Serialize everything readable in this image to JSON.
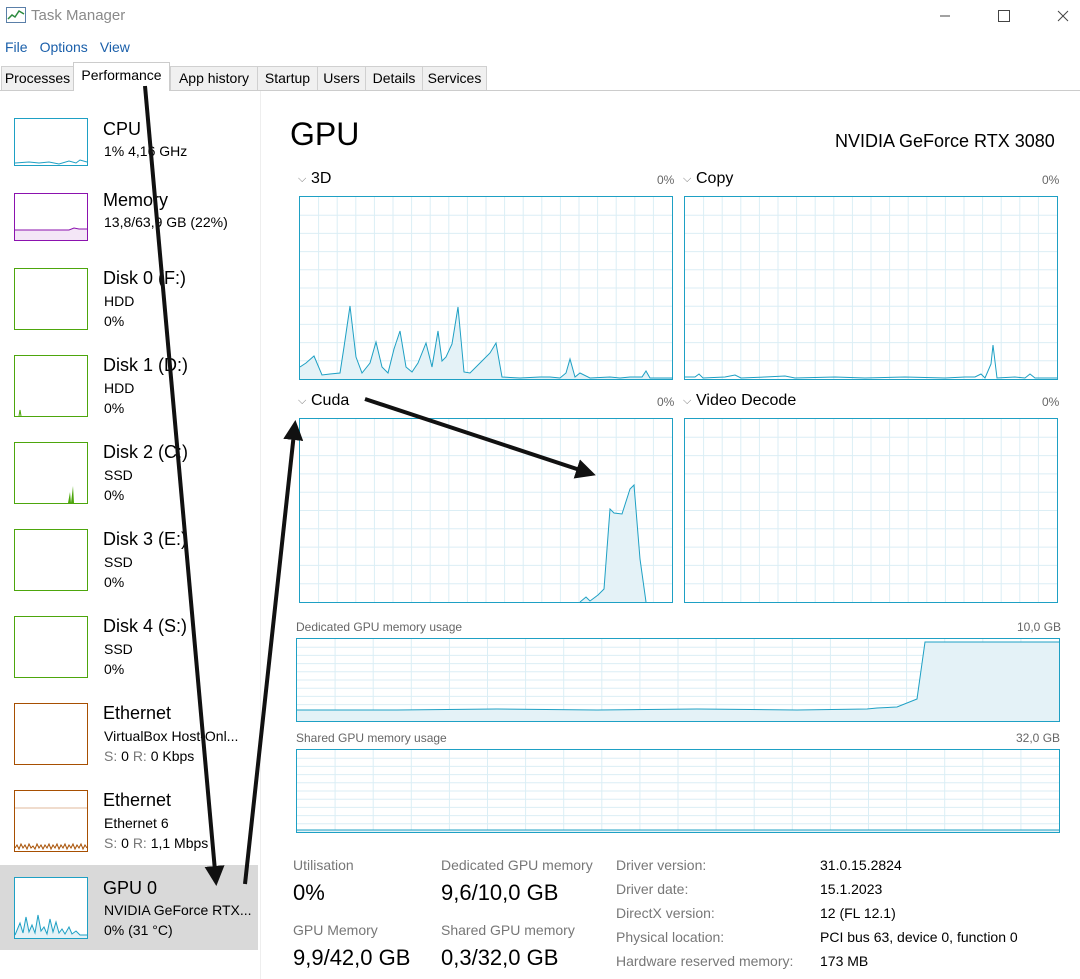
{
  "window": {
    "title": "Task Manager"
  },
  "menu": [
    "File",
    "Options",
    "View"
  ],
  "tabs": [
    "Processes",
    "Performance",
    "App history",
    "Startup",
    "Users",
    "Details",
    "Services"
  ],
  "sidebar": [
    {
      "name": "CPU",
      "line1": "1%  4,16 GHz",
      "line2": ""
    },
    {
      "name": "Memory",
      "line1": "13,8/63,9 GB (22%)",
      "line2": ""
    },
    {
      "name": "Disk 0 (F:)",
      "line1": "HDD",
      "line2": "0%"
    },
    {
      "name": "Disk 1 (D:)",
      "line1": "HDD",
      "line2": "0%"
    },
    {
      "name": "Disk 2 (C:)",
      "line1": "SSD",
      "line2": "0%"
    },
    {
      "name": "Disk 3 (E:)",
      "line1": "SSD",
      "line2": "0%"
    },
    {
      "name": "Disk 4 (S:)",
      "line1": "SSD",
      "line2": "0%"
    },
    {
      "name": "Ethernet",
      "line1": "VirtualBox Host-Onl...",
      "line2": {
        "s_label": "S:",
        "s": "0",
        "r_label": "R:",
        "r": "0 Kbps"
      }
    },
    {
      "name": "Ethernet",
      "line1": "Ethernet 6",
      "line2": {
        "s_label": "S:",
        "s": "0",
        "r_label": "R:",
        "r": "1,1 Mbps"
      }
    },
    {
      "name": "GPU 0",
      "line1": "NVIDIA GeForce RTX...",
      "line2": "0%  (31 °C)"
    }
  ],
  "gpu": {
    "heading": "GPU",
    "model": "NVIDIA GeForce RTX 3080",
    "engines": [
      {
        "label": "3D",
        "percent": "0%"
      },
      {
        "label": "Copy",
        "percent": "0%"
      },
      {
        "label": "Cuda",
        "percent": "0%"
      },
      {
        "label": "Video Decode",
        "percent": "0%"
      }
    ],
    "dedicated_mem": {
      "label": "Dedicated GPU memory usage",
      "max": "10,0 GB"
    },
    "shared_mem": {
      "label": "Shared GPU memory usage",
      "max": "32,0 GB"
    }
  },
  "stats": [
    {
      "label": "Utilisation",
      "value": "0%"
    },
    {
      "label": "Dedicated GPU memory",
      "value": "9,6/10,0 GB"
    },
    {
      "label": "GPU Memory",
      "value": "9,9/42,0 GB"
    },
    {
      "label": "Shared GPU memory",
      "value": "0,3/32,0 GB"
    }
  ],
  "info": [
    {
      "label": "Driver version:",
      "value": "31.0.15.2824"
    },
    {
      "label": "Driver date:",
      "value": "15.1.2023"
    },
    {
      "label": "DirectX version:",
      "value": "12 (FL 12.1)"
    },
    {
      "label": "Physical location:",
      "value": "PCI bus 63, device 0, function 0"
    },
    {
      "label": "Hardware reserved memory:",
      "value": "173 MB"
    }
  ],
  "colors": {
    "gpu": "#1ea0c4",
    "cpu": "#1ea0c4",
    "memory": "#8b12ae",
    "disk": "#4da60c",
    "ethernet": "#a74f01"
  }
}
